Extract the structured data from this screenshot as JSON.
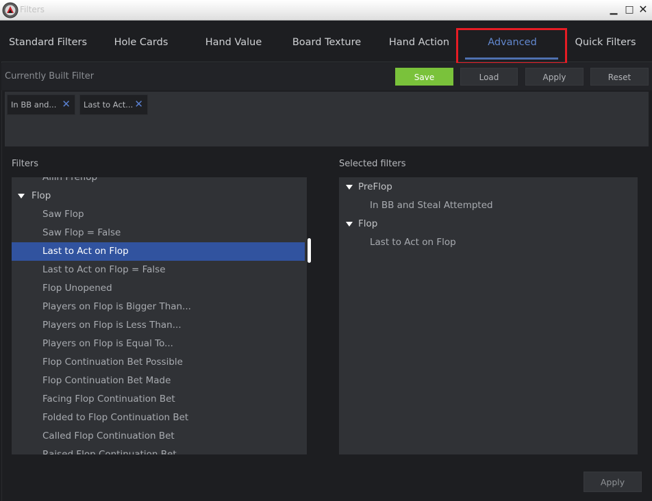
{
  "window": {
    "title": "Filters",
    "minimize": "▁",
    "maximize": "□",
    "close": "✕"
  },
  "tabs": [
    {
      "label": "Standard Filters",
      "active": false
    },
    {
      "label": "Hole Cards",
      "active": false
    },
    {
      "label": "Hand Value",
      "active": false
    },
    {
      "label": "Board Texture",
      "active": false
    },
    {
      "label": "Hand Action",
      "active": false
    },
    {
      "label": "Advanced",
      "active": true
    },
    {
      "label": "Quick Filters",
      "active": false
    }
  ],
  "built_filter": {
    "title": "Currently Built Filter",
    "buttons": {
      "save": "Save",
      "load": "Load",
      "apply": "Apply",
      "reset": "Reset"
    },
    "chips": [
      {
        "label": "In BB and...",
        "remove": "✕"
      },
      {
        "label": "Last to Act...",
        "remove": "✕"
      }
    ]
  },
  "filters_panel": {
    "title": "Filters",
    "items": [
      {
        "label": "Allin Preflop",
        "type": "item"
      },
      {
        "label": "Flop",
        "type": "group"
      },
      {
        "label": "Saw Flop",
        "type": "item"
      },
      {
        "label": "Saw Flop = False",
        "type": "item"
      },
      {
        "label": "Last to Act on Flop",
        "type": "item",
        "selected": true
      },
      {
        "label": "Last to Act on Flop = False",
        "type": "item"
      },
      {
        "label": "Flop Unopened",
        "type": "item"
      },
      {
        "label": "Players on Flop is Bigger Than...",
        "type": "item"
      },
      {
        "label": "Players on Flop is Less Than...",
        "type": "item"
      },
      {
        "label": "Players on Flop is Equal To...",
        "type": "item"
      },
      {
        "label": "Flop Continuation Bet Possible",
        "type": "item"
      },
      {
        "label": "Flop Continuation Bet Made",
        "type": "item"
      },
      {
        "label": "Facing Flop Continuation Bet",
        "type": "item"
      },
      {
        "label": "Folded to Flop Continuation Bet",
        "type": "item"
      },
      {
        "label": "Called Flop Continuation Bet",
        "type": "item"
      },
      {
        "label": "Raised Flop Continuation Bet",
        "type": "item"
      }
    ]
  },
  "selected_panel": {
    "title": "Selected filters",
    "items": [
      {
        "label": "PreFlop",
        "type": "group"
      },
      {
        "label": "In BB and Steal Attempted",
        "type": "item"
      },
      {
        "label": "Flop",
        "type": "group"
      },
      {
        "label": "Last to Act on Flop",
        "type": "item"
      }
    ]
  },
  "footer": {
    "apply": "Apply"
  },
  "colors": {
    "accent": "#6288cf",
    "save": "#7ac23b",
    "selection": "#31539f",
    "highlight": "#e61c24"
  }
}
